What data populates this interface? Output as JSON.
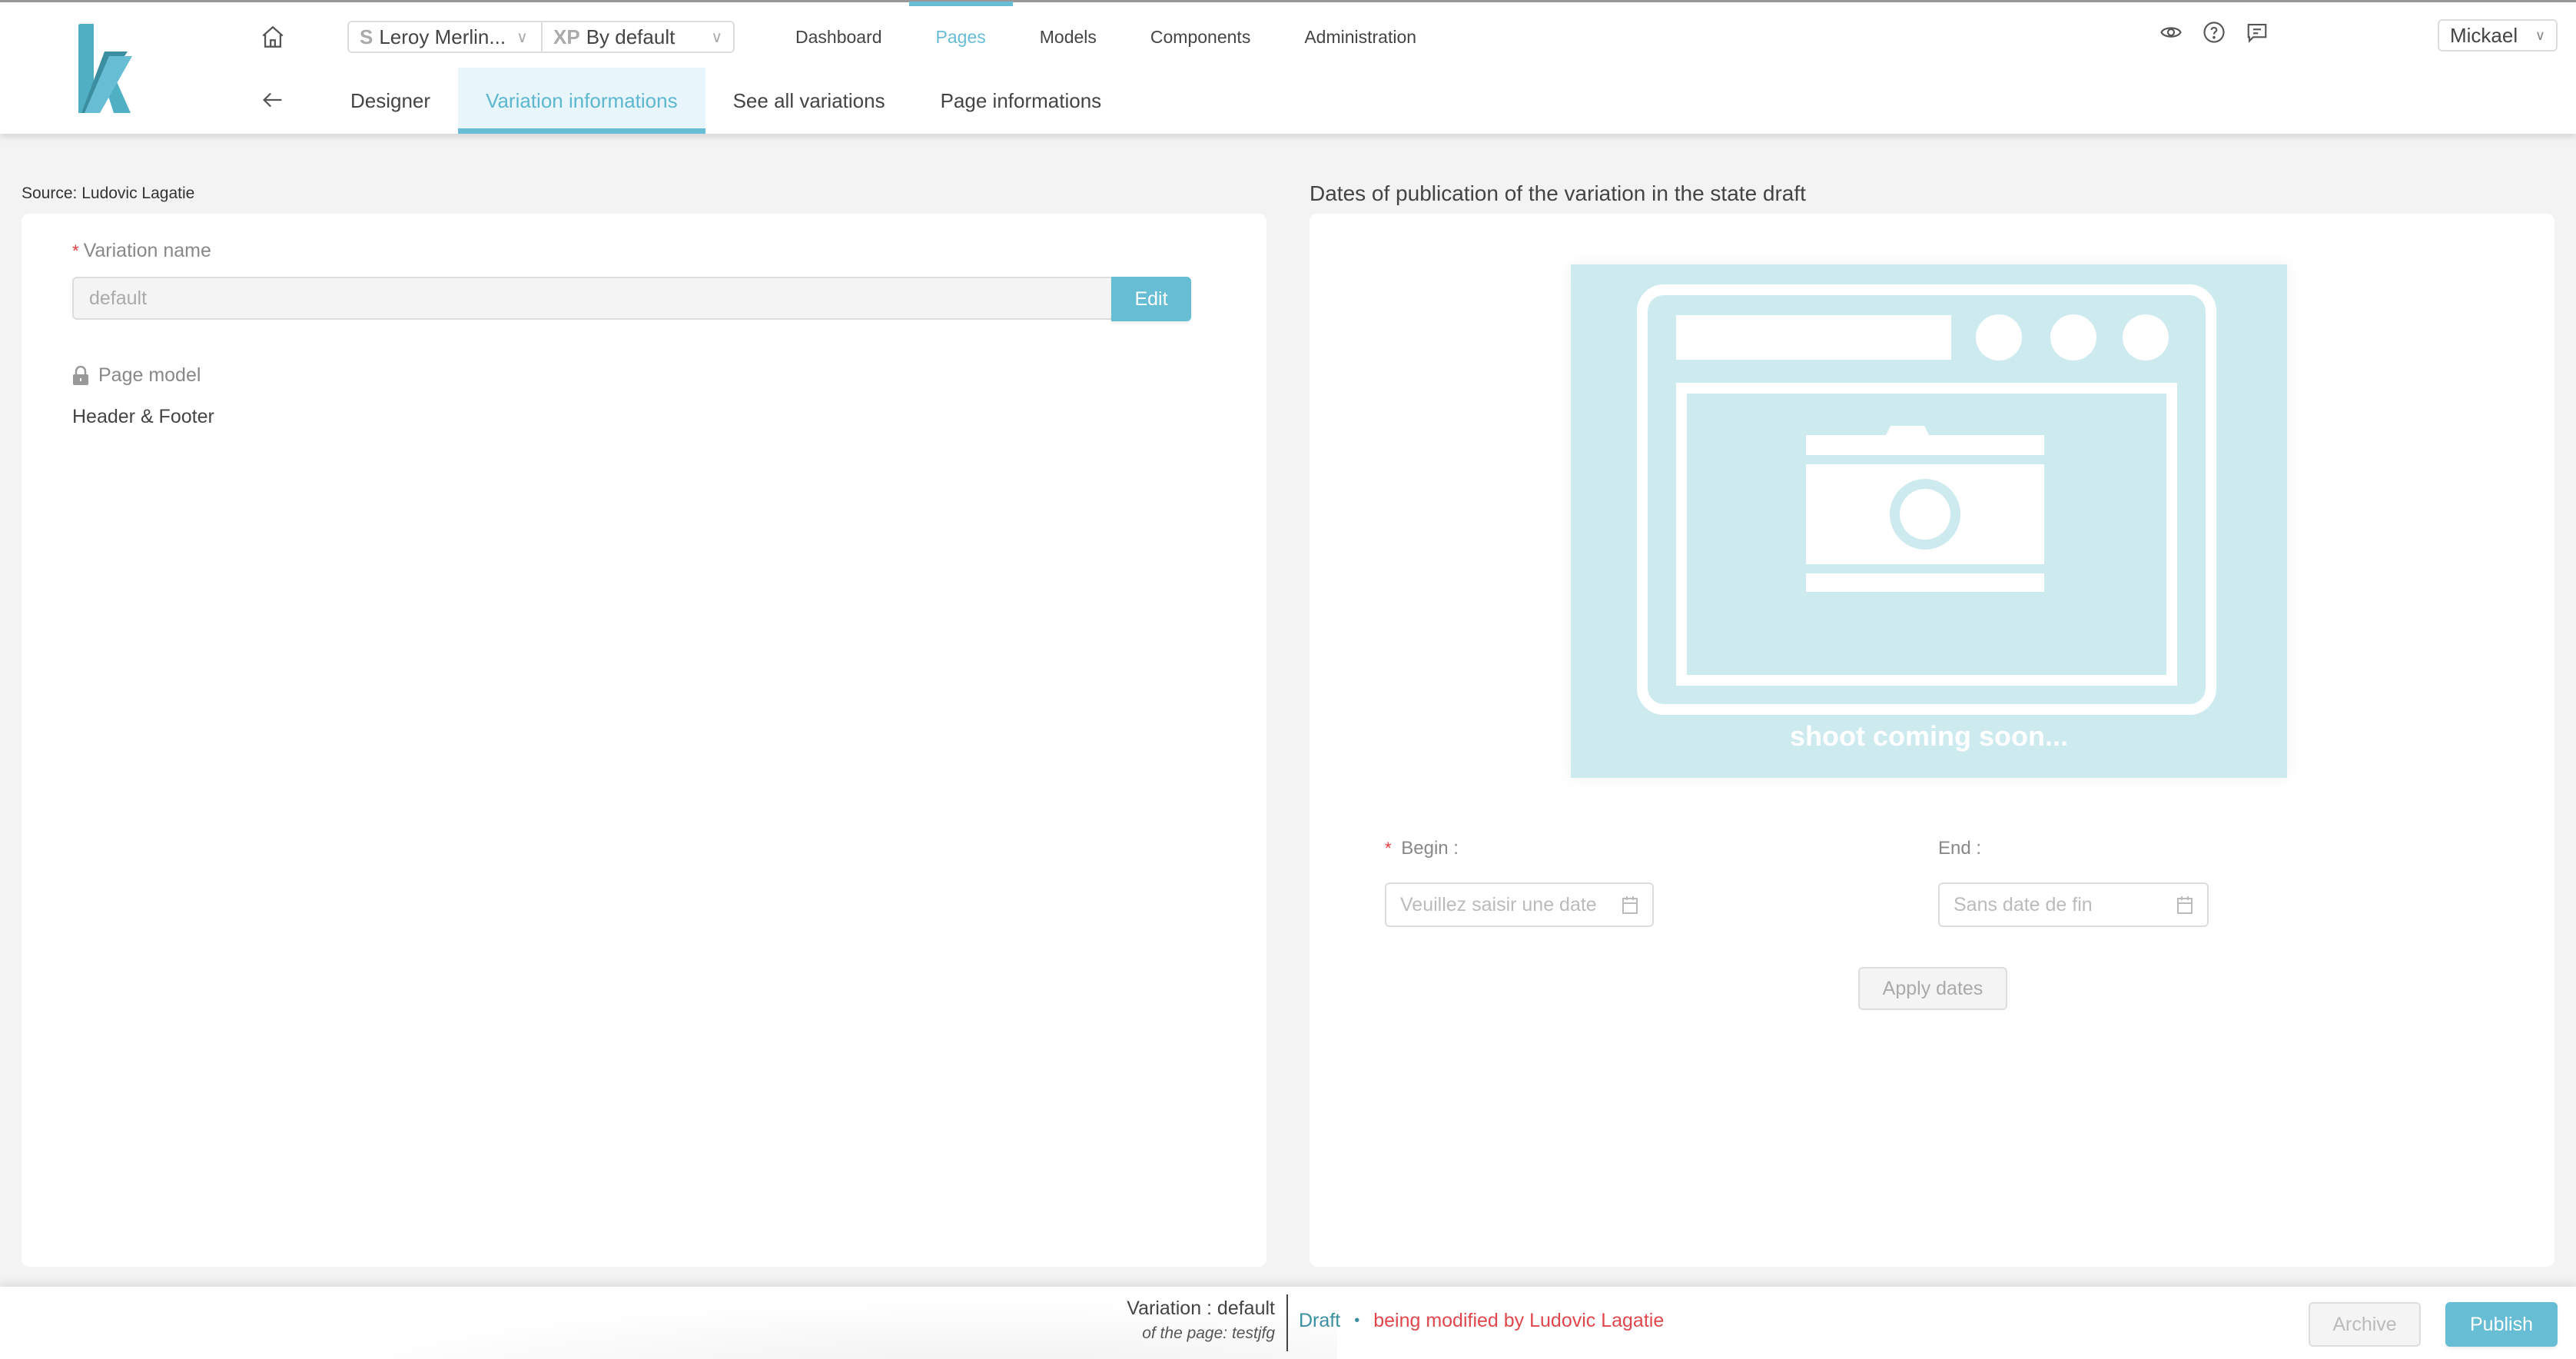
{
  "header": {
    "logo": "k-logo",
    "home_icon": "home-icon",
    "back_icon": "arrow-left-icon",
    "site_selector": {
      "prefix": "S",
      "value": "Leroy Merlin...",
      "icon": "chevron-down-icon"
    },
    "experience_selector": {
      "prefix": "XP",
      "value": "By default",
      "icon": "chevron-down-icon"
    },
    "nav": [
      {
        "label": "Dashboard",
        "active": false
      },
      {
        "label": "Pages",
        "active": true
      },
      {
        "label": "Models",
        "active": false
      },
      {
        "label": "Components",
        "active": false
      },
      {
        "label": "Administration",
        "active": false
      }
    ],
    "tabs": [
      {
        "label": "Designer",
        "active": false
      },
      {
        "label": "Variation informations",
        "active": true
      },
      {
        "label": "See all variations",
        "active": false
      },
      {
        "label": "Page informations",
        "active": false
      }
    ],
    "icons": [
      "eye-icon",
      "help-icon",
      "comment-icon"
    ],
    "user": {
      "name": "Mickael",
      "icon": "chevron-down-icon"
    }
  },
  "left": {
    "source": "Source: Ludovic Lagatie",
    "variation_name_label": "Variation name",
    "required_mark": "*",
    "variation_name_value": "default",
    "edit_label": "Edit",
    "page_model_label": "Page model",
    "page_model_value": "Header & Footer"
  },
  "right": {
    "title": "Dates of publication of the variation in the state draft",
    "preview_caption": "shoot coming soon...",
    "begin_label": "Begin :",
    "begin_placeholder": "Veuillez saisir une date",
    "end_label": "End :",
    "end_placeholder": "Sans date de fin",
    "apply_label": "Apply dates"
  },
  "footer": {
    "variation_line": "Variation : default",
    "page_line": "of the page: testjfg",
    "status": "Draft",
    "separator": "•",
    "modified_by": "being modified by Ludovic Lagatie",
    "archive_label": "Archive",
    "publish_label": "Publish"
  },
  "colors": {
    "accent": "#66bdd4",
    "active_tab_bg": "#e8f5fb",
    "preview_bg": "#cdeaef",
    "status_draft": "#3a8fa0",
    "status_modified": "#e0474c",
    "required": "#e23b3b"
  }
}
